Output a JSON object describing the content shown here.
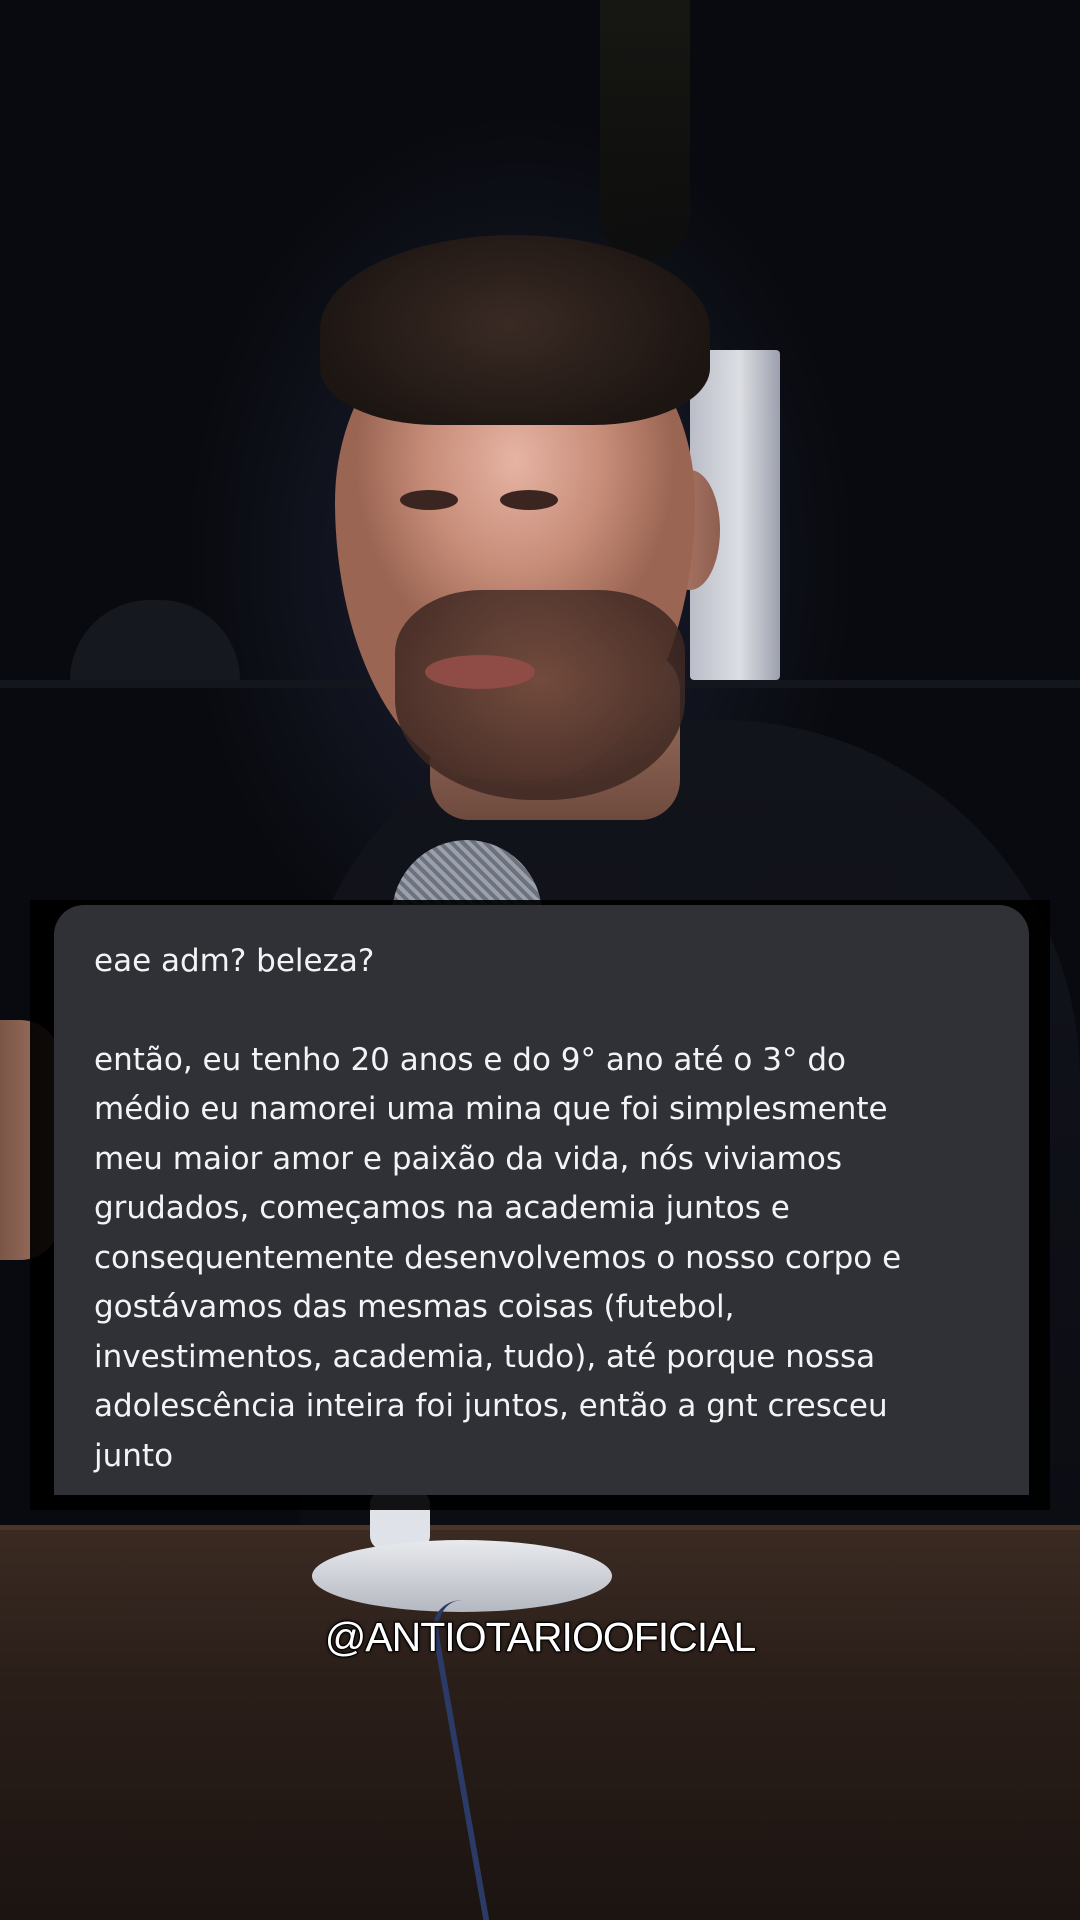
{
  "message": {
    "greeting": "eae adm? beleza?",
    "body_lines": [
      "então, eu tenho 20 anos e do 9° ano até o 3° do",
      "médio eu namorei uma mina que foi simplesmente",
      "meu maior amor e paixão da vida, nós viviamos",
      "grudados, começamos na academia juntos e",
      "consequentemente desenvolvemos o nosso corpo e",
      "gostávamos das mesmas coisas (futebol,",
      "investimentos, academia, tudo), até porque nossa",
      "adolescência inteira foi juntos, então a gnt cresceu",
      "junto"
    ]
  },
  "watermark": {
    "handle": "@ANTIOTARIOOFICIAL"
  },
  "colors": {
    "card_background": "#2f3136",
    "card_text": "#f2f3f5",
    "backdrop": "#000000"
  }
}
